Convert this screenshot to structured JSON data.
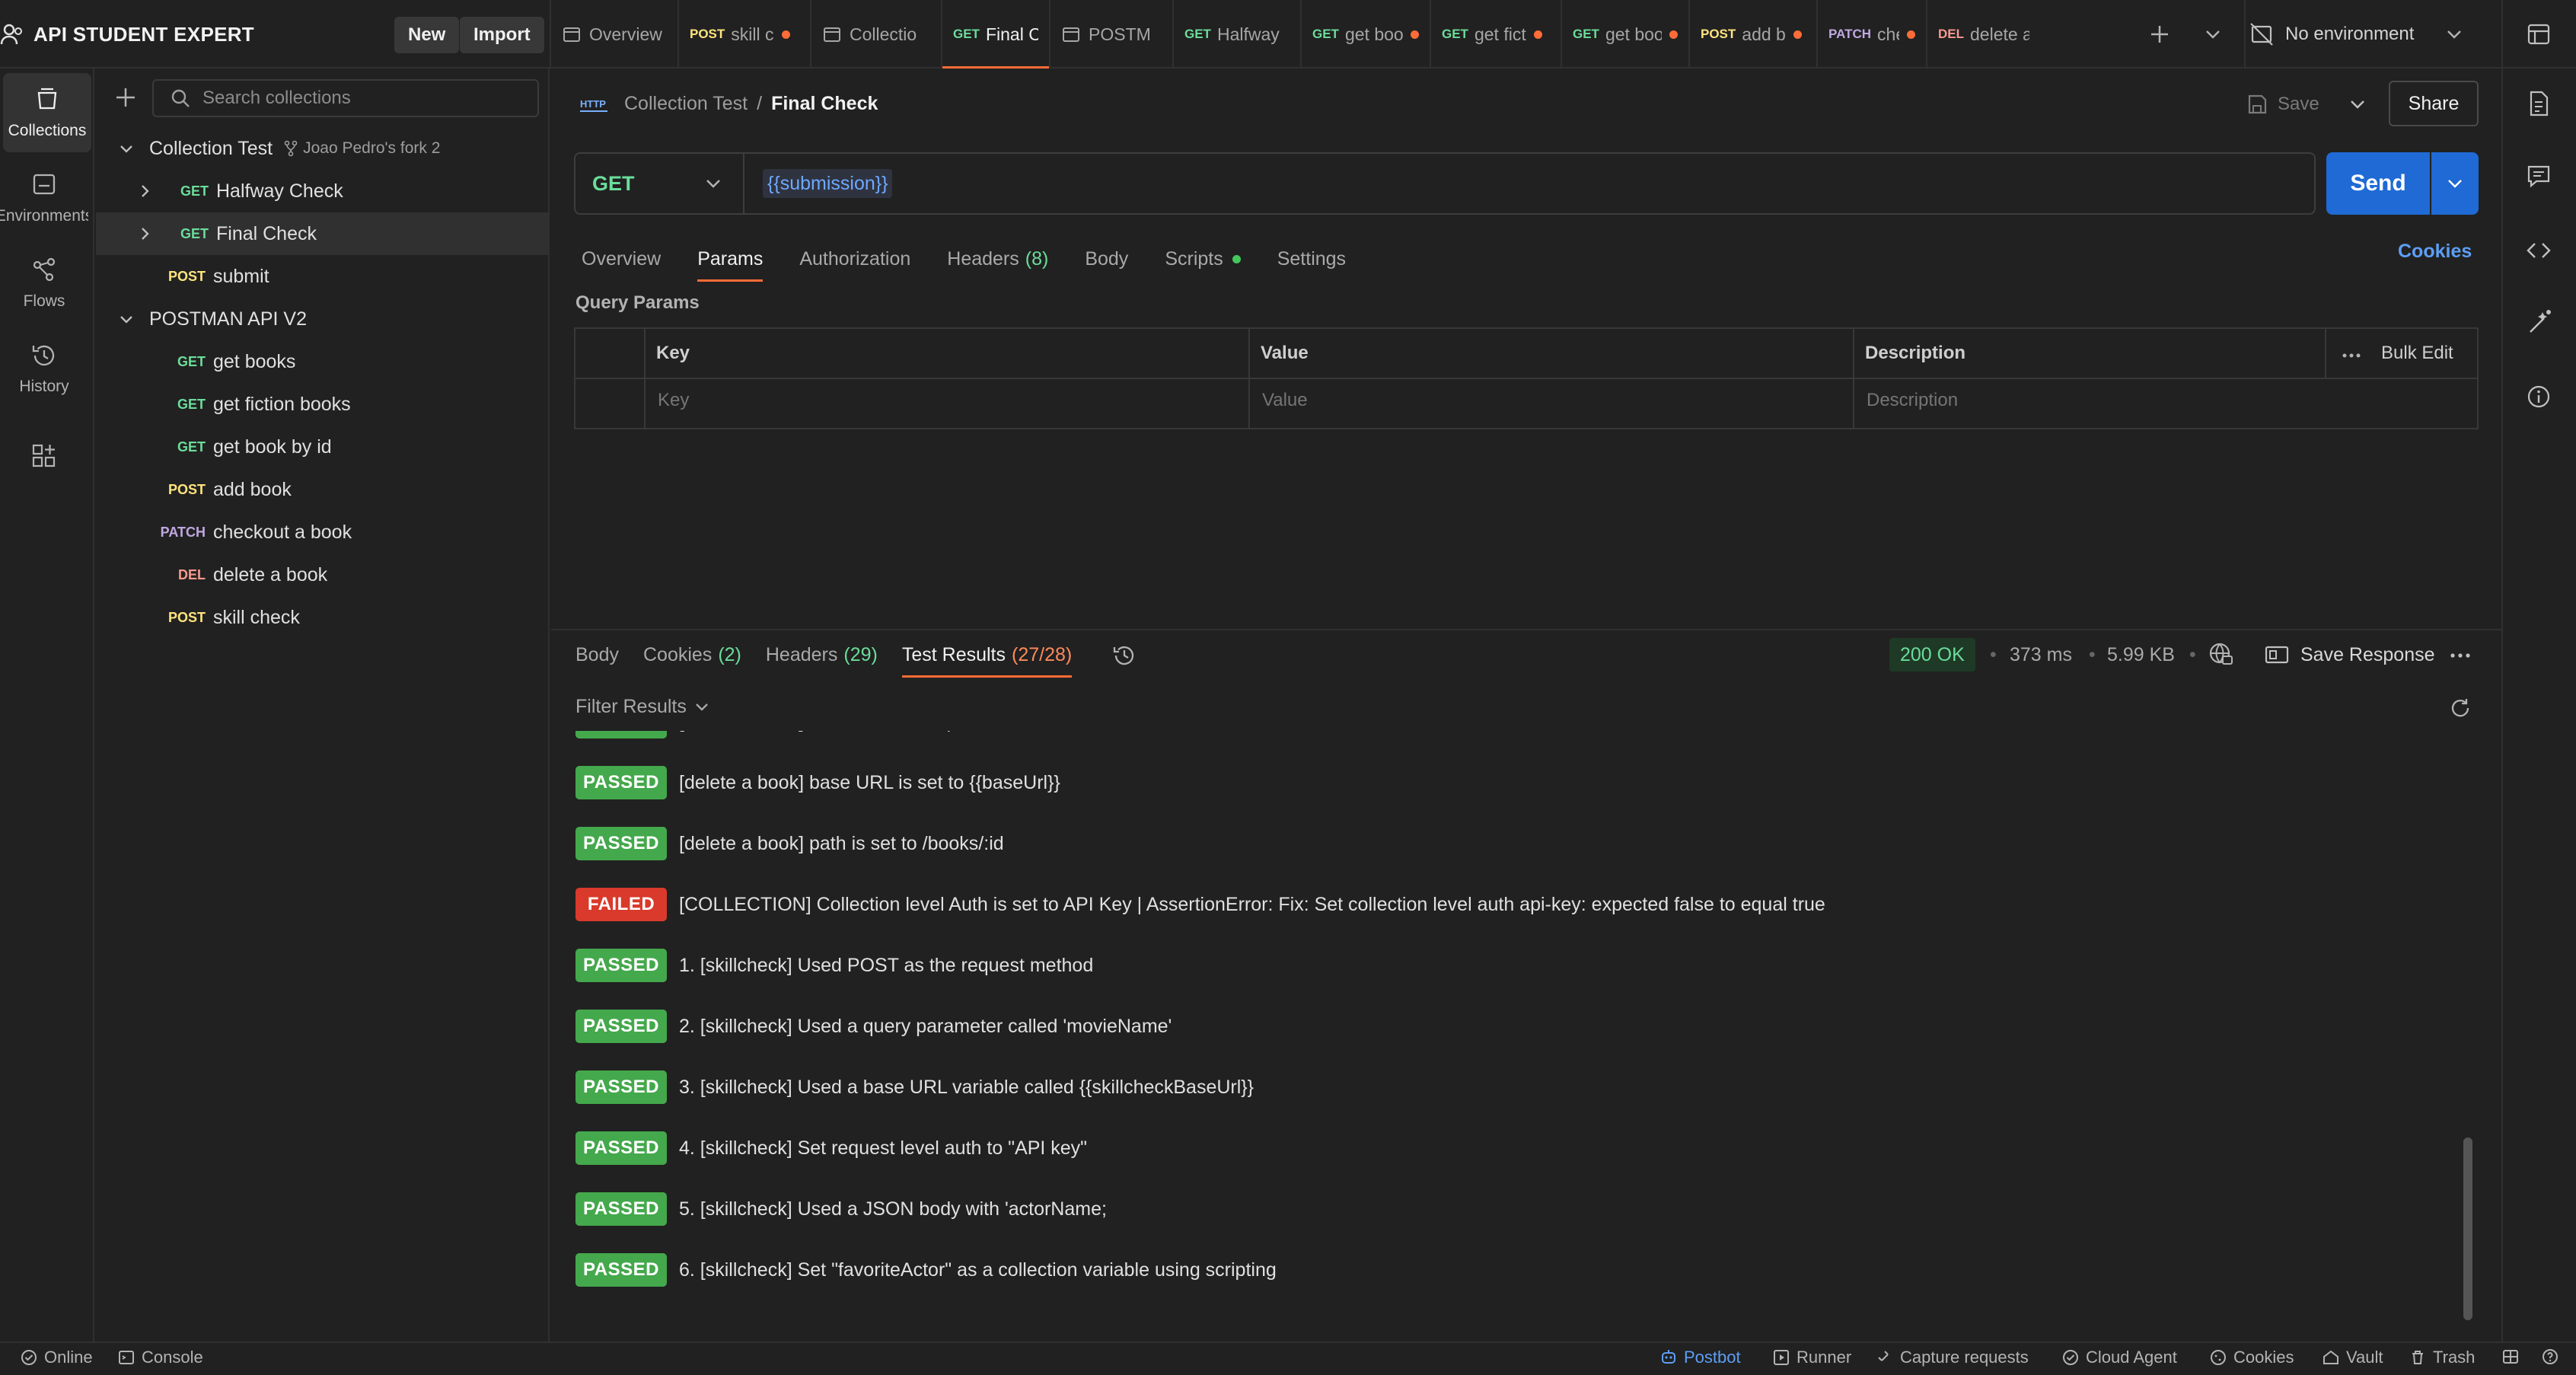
{
  "workspace": {
    "title": "API STUDENT EXPERT",
    "new_label": "New",
    "import_label": "Import"
  },
  "tabs": [
    {
      "method": "",
      "label": "Overview",
      "dot": false,
      "active": false,
      "icon": "overview-icon"
    },
    {
      "method": "POST",
      "label": "skill c",
      "dot": true,
      "active": false
    },
    {
      "method": "",
      "label": "Collectio",
      "dot": false,
      "active": false,
      "icon": "collection-icon"
    },
    {
      "method": "GET",
      "label": "Final Ch",
      "dot": false,
      "active": true
    },
    {
      "method": "",
      "label": "POSTM",
      "dot": false,
      "active": false,
      "icon": "collection-icon"
    },
    {
      "method": "GET",
      "label": "Halfway",
      "dot": false,
      "active": false
    },
    {
      "method": "GET",
      "label": "get boo",
      "dot": true,
      "active": false
    },
    {
      "method": "GET",
      "label": "get fict",
      "dot": true,
      "active": false
    },
    {
      "method": "GET",
      "label": "get boo",
      "dot": true,
      "active": false
    },
    {
      "method": "POST",
      "label": "add b",
      "dot": true,
      "active": false
    },
    {
      "method": "PATCH",
      "label": "chec",
      "dot": true,
      "active": false
    },
    {
      "method": "DEL",
      "label": "delete a",
      "dot": false,
      "active": false
    }
  ],
  "environment": {
    "label": "No environment"
  },
  "rail": [
    {
      "label": "Collections",
      "icon": "collections-icon",
      "active": true
    },
    {
      "label": "Environments",
      "icon": "environments-icon",
      "active": false
    },
    {
      "label": "Flows",
      "icon": "flows-icon",
      "active": false
    },
    {
      "label": "History",
      "icon": "history-icon",
      "active": false
    },
    {
      "label": "",
      "icon": "add-apps-icon",
      "active": false
    }
  ],
  "sidebar": {
    "search_placeholder": "Search collections",
    "tree": [
      {
        "type": "collection",
        "label": "Collection Test",
        "fork": "Joao Pedro's fork 2",
        "indent": 0,
        "expanded": true
      },
      {
        "type": "request",
        "method": "GET",
        "label": "Halfway Check",
        "indent": 1,
        "chevron": true
      },
      {
        "type": "request",
        "method": "GET",
        "label": "Final Check",
        "indent": 1,
        "chevron": true,
        "selected": true
      },
      {
        "type": "request",
        "method": "POST",
        "label": "submit",
        "indent": 1,
        "chevron": false
      },
      {
        "type": "collection",
        "label": "POSTMAN API V2",
        "fork": "",
        "indent": 0,
        "expanded": true
      },
      {
        "type": "request",
        "method": "GET",
        "label": "get books",
        "indent": 1
      },
      {
        "type": "request",
        "method": "GET",
        "label": "get fiction books",
        "indent": 1
      },
      {
        "type": "request",
        "method": "GET",
        "label": "get book by id",
        "indent": 1
      },
      {
        "type": "request",
        "method": "POST",
        "label": "add book",
        "indent": 1
      },
      {
        "type": "request",
        "method": "PATCH",
        "label": "checkout a book",
        "indent": 1
      },
      {
        "type": "request",
        "method": "DEL",
        "label": "delete a book",
        "indent": 1
      },
      {
        "type": "request",
        "method": "POST",
        "label": "skill check",
        "indent": 1
      }
    ]
  },
  "request": {
    "breadcrumb_parent": "Collection Test",
    "breadcrumb_sep": "/",
    "breadcrumb_current": "Final Check",
    "save_label": "Save",
    "share_label": "Share",
    "method": "GET",
    "url": "{{submission}}",
    "send_label": "Send",
    "tabs": [
      {
        "label": "Overview",
        "count": "",
        "active": false,
        "dot": false
      },
      {
        "label": "Params",
        "count": "",
        "active": true,
        "dot": false
      },
      {
        "label": "Authorization",
        "count": "",
        "active": false,
        "dot": false
      },
      {
        "label": "Headers",
        "count": "(8)",
        "active": false,
        "dot": false
      },
      {
        "label": "Body",
        "count": "",
        "active": false,
        "dot": false
      },
      {
        "label": "Scripts",
        "count": "",
        "active": false,
        "dot": true
      },
      {
        "label": "Settings",
        "count": "",
        "active": false,
        "dot": false
      }
    ],
    "cookies_label": "Cookies",
    "query_params_title": "Query Params",
    "columns": {
      "key": "Key",
      "value": "Value",
      "description": "Description",
      "bulk_edit": "Bulk Edit"
    },
    "placeholders": {
      "key": "Key",
      "value": "Value",
      "description": "Description"
    }
  },
  "response": {
    "tabs": [
      {
        "label": "Body",
        "count": "",
        "active": false
      },
      {
        "label": "Cookies",
        "count": "(2)",
        "active": false
      },
      {
        "label": "Headers",
        "count": "(29)",
        "active": false
      },
      {
        "label": "Test Results",
        "count": "(27/28)",
        "active": true
      }
    ],
    "status": "200 OK",
    "time": "373 ms",
    "size": "5.99 KB",
    "save_response_label": "Save Response",
    "filter_label": "Filter Results",
    "results": [
      {
        "status": "PASSED",
        "text": "[delete a book] is a DELETE request"
      },
      {
        "status": "PASSED",
        "text": "[delete a book] base URL is set to {{baseUrl}}"
      },
      {
        "status": "PASSED",
        "text": "[delete a book] path is set to /books/:id"
      },
      {
        "status": "FAILED",
        "text": "[COLLECTION] Collection level Auth is set to API Key | AssertionError: Fix: Set collection level auth api-key: expected false to equal true"
      },
      {
        "status": "PASSED",
        "text": "1. [skillcheck] Used POST as the request method"
      },
      {
        "status": "PASSED",
        "text": "2. [skillcheck] Used a query parameter called 'movieName'"
      },
      {
        "status": "PASSED",
        "text": "3. [skillcheck] Used a base URL variable called {{skillcheckBaseUrl}}"
      },
      {
        "status": "PASSED",
        "text": "4. [skillcheck] Set request level auth to \"API key\""
      },
      {
        "status": "PASSED",
        "text": "5. [skillcheck] Used a JSON body with 'actorName;"
      },
      {
        "status": "PASSED",
        "text": "6. [skillcheck] Set \"favoriteActor\" as a collection variable using scripting"
      }
    ]
  },
  "statusbar": {
    "online": "Online",
    "console": "Console",
    "postbot": "Postbot",
    "runner": "Runner",
    "capture": "Capture requests",
    "cloud_agent": "Cloud Agent",
    "cookies": "Cookies",
    "vault": "Vault",
    "trash": "Trash"
  },
  "colors": {
    "accent": "#ff6c37",
    "send": "#1f6ad4",
    "pass": "#44a84c",
    "fail": "#d93a2b",
    "get": "#6bdd9a",
    "post": "#ffe47e"
  }
}
